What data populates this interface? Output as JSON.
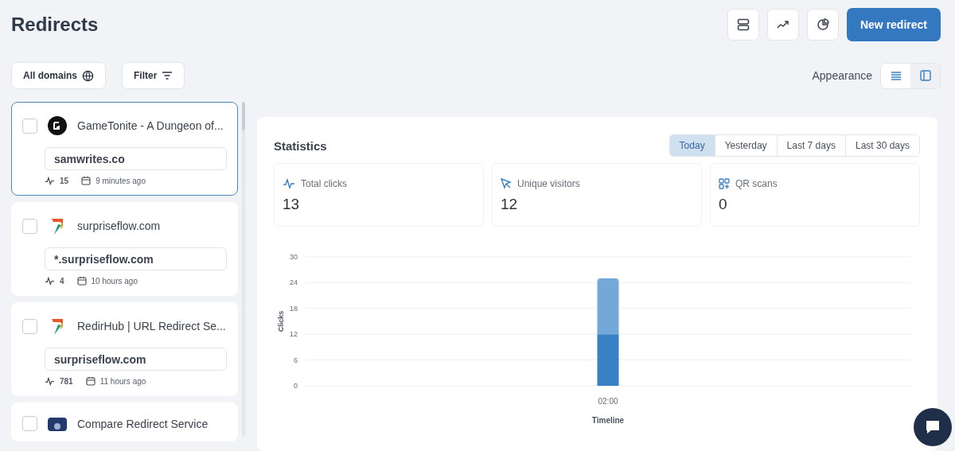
{
  "header": {
    "title": "Redirects",
    "primary_button": "New redirect"
  },
  "toolbar": {
    "domains_button": "All domains",
    "filter_button": "Filter",
    "appearance_label": "Appearance",
    "appearance_options": [
      {
        "kind": "list",
        "selected": true
      },
      {
        "kind": "panel",
        "selected": false
      }
    ]
  },
  "redirects": [
    {
      "title": "GameTonite - A Dungeon of...",
      "kind": "dark",
      "url": "samwrites.co",
      "clicks": "15",
      "time": "9 minutes ago",
      "selected": true,
      "checked": false
    },
    {
      "title": "surpriseflow.com",
      "kind": "arrow",
      "url": "*.surpriseflow.com",
      "clicks": "4",
      "time": "10 hours ago",
      "selected": false,
      "checked": false
    },
    {
      "title": "RedirHub | URL Redirect Se...",
      "kind": "arrow",
      "url": "surpriseflow.com",
      "clicks": "781",
      "time": "11 hours ago",
      "selected": false,
      "checked": false
    },
    {
      "title": "Compare Redirect Service",
      "kind": "badge",
      "selected": false,
      "checked": false
    }
  ],
  "statistics": {
    "title": "Statistics",
    "ranges": [
      {
        "label": "Today",
        "selected": true
      },
      {
        "label": "Yesterday",
        "selected": false
      },
      {
        "label": "Last 7 days",
        "selected": false
      },
      {
        "label": "Last 30 days",
        "selected": false
      }
    ],
    "metrics": [
      {
        "kind": "clicks",
        "label": "Total clicks",
        "value": "13"
      },
      {
        "kind": "visitors",
        "label": "Unique visitors",
        "value": "12"
      },
      {
        "kind": "qr",
        "label": "QR scans",
        "value": "0"
      }
    ],
    "chart_data": {
      "type": "bar",
      "xlabel": "Timeline",
      "ylabel": "Clicks",
      "categories": [
        "02:00"
      ],
      "stacked": true,
      "grid": true,
      "ylim": [
        0,
        30
      ],
      "yticks": [
        0,
        6,
        12,
        18,
        24,
        30
      ],
      "series": [
        {
          "color": "#3a80c4",
          "values": [
            12
          ]
        },
        {
          "color": "#74a8d8",
          "values": [
            13
          ]
        }
      ]
    }
  }
}
